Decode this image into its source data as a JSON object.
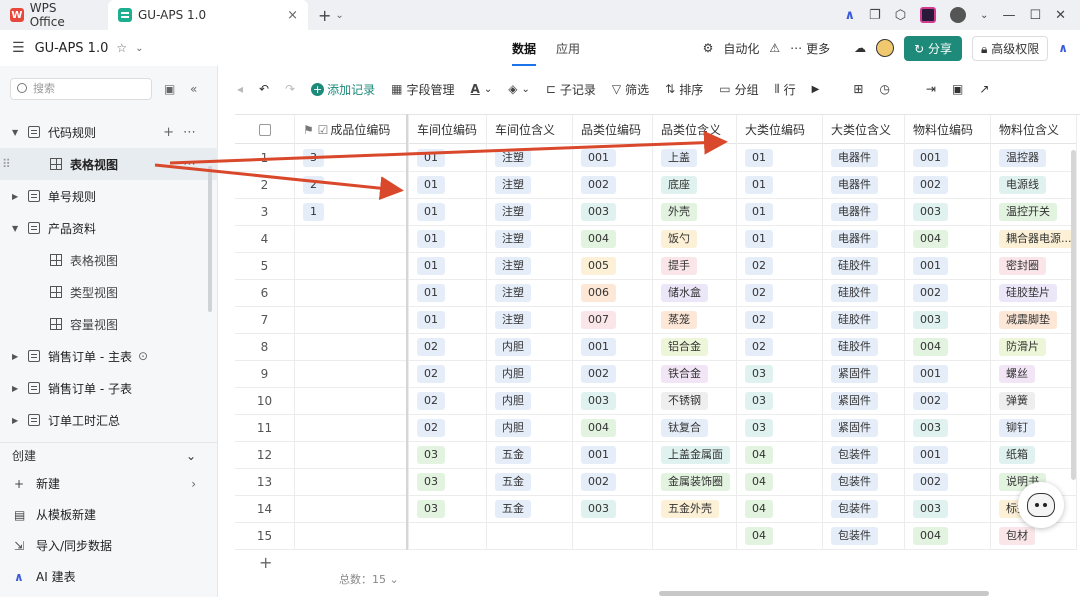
{
  "titlebar": {
    "tabs": [
      {
        "label": "WPS Office"
      },
      {
        "label": "GU-APS 1.0"
      }
    ],
    "new_tab": "+",
    "close": "×"
  },
  "header": {
    "doc_title": "GU-APS 1.0",
    "view_tabs": [
      "数据",
      "应用"
    ],
    "automation": "自动化",
    "more": "更多",
    "share": "分享",
    "permission": "高级权限"
  },
  "sidebar": {
    "search_placeholder": "搜索",
    "items": [
      {
        "label": "代码规则",
        "level": 0,
        "expanded": true
      },
      {
        "label": "表格视图",
        "level": 1,
        "selected": true
      },
      {
        "label": "单号规则",
        "level": 0,
        "expanded": false
      },
      {
        "label": "产品资料",
        "level": 0,
        "expanded": true
      },
      {
        "label": "表格视图",
        "level": 1
      },
      {
        "label": "类型视图",
        "level": 1
      },
      {
        "label": "容量视图",
        "level": 1
      },
      {
        "label": "销售订单 - 主表",
        "level": 0,
        "expanded": false
      },
      {
        "label": "销售订单 - 子表",
        "level": 0,
        "expanded": false
      },
      {
        "label": "订单工时汇总",
        "level": 0,
        "expanded": false
      }
    ],
    "create_heading": "创建",
    "create_items": [
      "新建",
      "从模板新建",
      "导入/同步数据",
      "AI 建表"
    ]
  },
  "toolbar": {
    "add_record": "添加记录",
    "field_manage": "字段管理",
    "sub_record": "子记录",
    "filter": "筛选",
    "sort": "排序",
    "group": "分组",
    "row": "行"
  },
  "table": {
    "columns": [
      "成品位编码",
      "车间位编码",
      "车间位含义",
      "品类位编码",
      "品类位含义",
      "大类位编码",
      "大类位含义",
      "物料位编码",
      "物料位含义"
    ],
    "rows": [
      {
        "n": "1",
        "c0": "3",
        "c1": "01",
        "c2": "注塑",
        "c3": "001",
        "c4": "上盖",
        "c5": "01",
        "c6": "电器件",
        "c7": "001",
        "c8": "温控器"
      },
      {
        "n": "2",
        "c0": "2",
        "c1": "01",
        "c2": "注塑",
        "c3": "002",
        "c4": "底座",
        "c5": "01",
        "c6": "电器件",
        "c7": "002",
        "c8": "电源线"
      },
      {
        "n": "3",
        "c0": "1",
        "c1": "01",
        "c2": "注塑",
        "c3": "003",
        "c4": "外壳",
        "c5": "01",
        "c6": "电器件",
        "c7": "003",
        "c8": "温控开关"
      },
      {
        "n": "4",
        "c0": "",
        "c1": "01",
        "c2": "注塑",
        "c3": "004",
        "c4": "饭勺",
        "c5": "01",
        "c6": "电器件",
        "c7": "004",
        "c8": "耦合器电源..."
      },
      {
        "n": "5",
        "c0": "",
        "c1": "01",
        "c2": "注塑",
        "c3": "005",
        "c4": "提手",
        "c5": "02",
        "c6": "硅胶件",
        "c7": "001",
        "c8": "密封圈"
      },
      {
        "n": "6",
        "c0": "",
        "c1": "01",
        "c2": "注塑",
        "c3": "006",
        "c4": "储水盒",
        "c5": "02",
        "c6": "硅胶件",
        "c7": "002",
        "c8": "硅胶垫片"
      },
      {
        "n": "7",
        "c0": "",
        "c1": "01",
        "c2": "注塑",
        "c3": "007",
        "c4": "蒸笼",
        "c5": "02",
        "c6": "硅胶件",
        "c7": "003",
        "c8": "减震脚垫"
      },
      {
        "n": "8",
        "c0": "",
        "c1": "02",
        "c2": "内胆",
        "c3": "001",
        "c4": "铝合金",
        "c5": "02",
        "c6": "硅胶件",
        "c7": "004",
        "c8": "防滑片"
      },
      {
        "n": "9",
        "c0": "",
        "c1": "02",
        "c2": "内胆",
        "c3": "002",
        "c4": "铁合金",
        "c5": "03",
        "c6": "紧固件",
        "c7": "001",
        "c8": "螺丝"
      },
      {
        "n": "10",
        "c0": "",
        "c1": "02",
        "c2": "内胆",
        "c3": "003",
        "c4": "不锈钢",
        "c5": "03",
        "c6": "紧固件",
        "c7": "002",
        "c8": "弹簧"
      },
      {
        "n": "11",
        "c0": "",
        "c1": "02",
        "c2": "内胆",
        "c3": "004",
        "c4": "钛复合",
        "c5": "03",
        "c6": "紧固件",
        "c7": "003",
        "c8": "铆钉"
      },
      {
        "n": "12",
        "c0": "",
        "c1": "03",
        "c2": "五金",
        "c3": "001",
        "c4": "上盖金属面",
        "c5": "04",
        "c6": "包装件",
        "c7": "001",
        "c8": "纸箱"
      },
      {
        "n": "13",
        "c0": "",
        "c1": "03",
        "c2": "五金",
        "c3": "002",
        "c4": "金属装饰圈",
        "c5": "04",
        "c6": "包装件",
        "c7": "002",
        "c8": "说明书"
      },
      {
        "n": "14",
        "c0": "",
        "c1": "03",
        "c2": "五金",
        "c3": "003",
        "c4": "五金外壳",
        "c5": "04",
        "c6": "包装件",
        "c7": "003",
        "c8": "标签"
      },
      {
        "n": "15",
        "c0": "",
        "c1": "",
        "c2": "",
        "c3": "",
        "c4": "",
        "c5": "04",
        "c6": "包装件",
        "c7": "004",
        "c8": "包材"
      }
    ]
  },
  "footer": {
    "total_label": "总数：",
    "total": "15"
  },
  "colors": {
    "accent": "#1e8a7a",
    "arrow": "#d9482b"
  }
}
